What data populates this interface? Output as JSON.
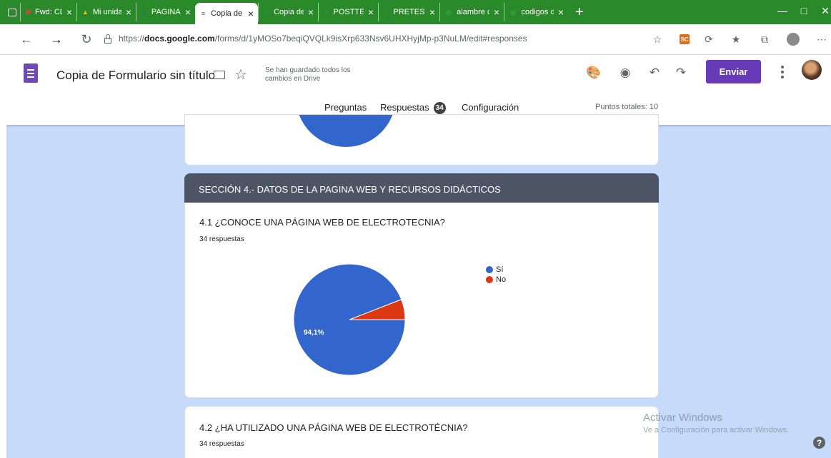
{
  "browser": {
    "tabs": [
      {
        "label": "Fwd: CLAV",
        "icon": "gmail-icon",
        "icon_glyph": "M",
        "icon_color": "#ea4335"
      },
      {
        "label": "Mi unidad",
        "icon": "drive-icon",
        "icon_glyph": "▲",
        "icon_color": "#fbbc04"
      },
      {
        "label": "PAGINA W",
        "icon": "sites-icon",
        "icon_glyph": "≡",
        "icon_color": "#3f51b5"
      },
      {
        "label": "Copia de F",
        "icon": "forms-icon",
        "icon_glyph": "≡",
        "icon_color": "#7248b9",
        "active": true
      },
      {
        "label": "Copia de F",
        "icon": "sheets-icon",
        "icon_glyph": "+",
        "icon_color": "#0f9d58"
      },
      {
        "label": "POSTTEST",
        "icon": "sheets-icon",
        "icon_glyph": "+",
        "icon_color": "#0f9d58"
      },
      {
        "label": "PRETEST C",
        "icon": "sheets-icon",
        "icon_glyph": "+",
        "icon_color": "#0f9d58"
      },
      {
        "label": "alambre d",
        "icon": "web-icon",
        "icon_glyph": "◎",
        "icon_color": "#34a853"
      },
      {
        "label": "codigos d",
        "icon": "web-icon",
        "icon_glyph": "◎",
        "icon_color": "#34a853"
      }
    ],
    "url_prefix": "https://",
    "url_host": "docs.google.com",
    "url_path": "/forms/d/1yMOSo7beqiQVQLk9isXrp633Nsv6UHXHyjMp-p3NuLM/edit#responses",
    "sc_badge": "SC"
  },
  "header": {
    "form_title": "Copia de Formulario sin título",
    "saved_status": "Se han guardado todos los cambios en Drive",
    "send_label": "Enviar",
    "tabs": {
      "questions": "Preguntas",
      "responses": "Respuestas",
      "responses_count": "34",
      "settings": "Configuración"
    },
    "total_points": "Puntos totales: 10"
  },
  "section": {
    "title": "SECCIÓN 4.- DATOS DE LA PAGINA WEB Y RECURSOS DIDÁCTICOS"
  },
  "questions": [
    {
      "title": "4.1 ¿CONOCE UNA PÁGINA WEB DE ELECTROTECNIA?",
      "responses_label": "34 respuestas"
    },
    {
      "title": "4.2 ¿HA UTILIZADO UNA PÁGINA WEB DE ELECTROTÉCNIA?",
      "responses_label": "34 respuestas"
    }
  ],
  "chart_data": {
    "type": "pie",
    "title": "",
    "slices": [
      {
        "label": "Sí",
        "value": 94.1,
        "color": "#3366cc",
        "data_label": "94,1%"
      },
      {
        "label": "No",
        "value": 5.9,
        "color": "#dc3912",
        "data_label": ""
      }
    ],
    "legend_position": "right"
  },
  "overlay": {
    "activate_title": "Activar Windows",
    "activate_sub": "Ve a Configuración para activar Windows.",
    "help": "?"
  }
}
